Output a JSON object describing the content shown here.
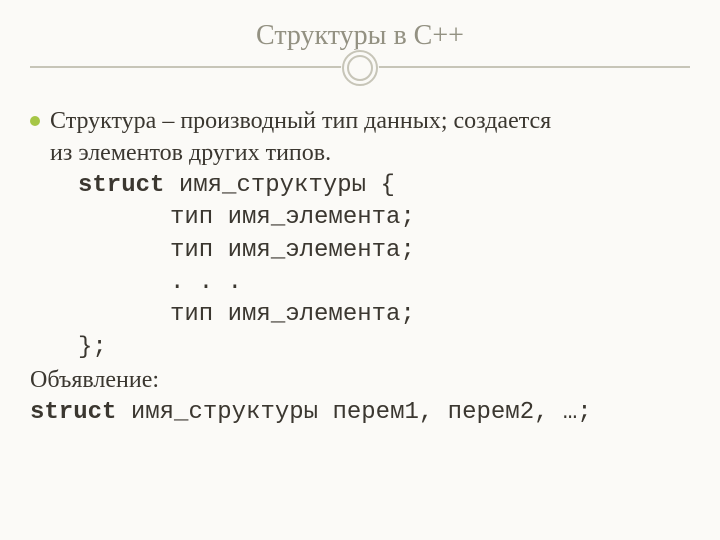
{
  "title": "Структуры в С++",
  "bullet": {
    "line1": "Структура – производный тип данных; создается",
    "line2": "из элементов других типов."
  },
  "code": {
    "l1a": "struct",
    "l1b": " имя_структуры {",
    "l2": "тип имя_элемента;",
    "l3": "тип имя_элемента;",
    "l4": ". . .",
    "l5": "тип имя_элемента;",
    "l6": "};"
  },
  "decl": {
    "label": "Объявление:",
    "kw": "struct",
    "rest": " имя_структуры перем1, перем2, …;"
  }
}
